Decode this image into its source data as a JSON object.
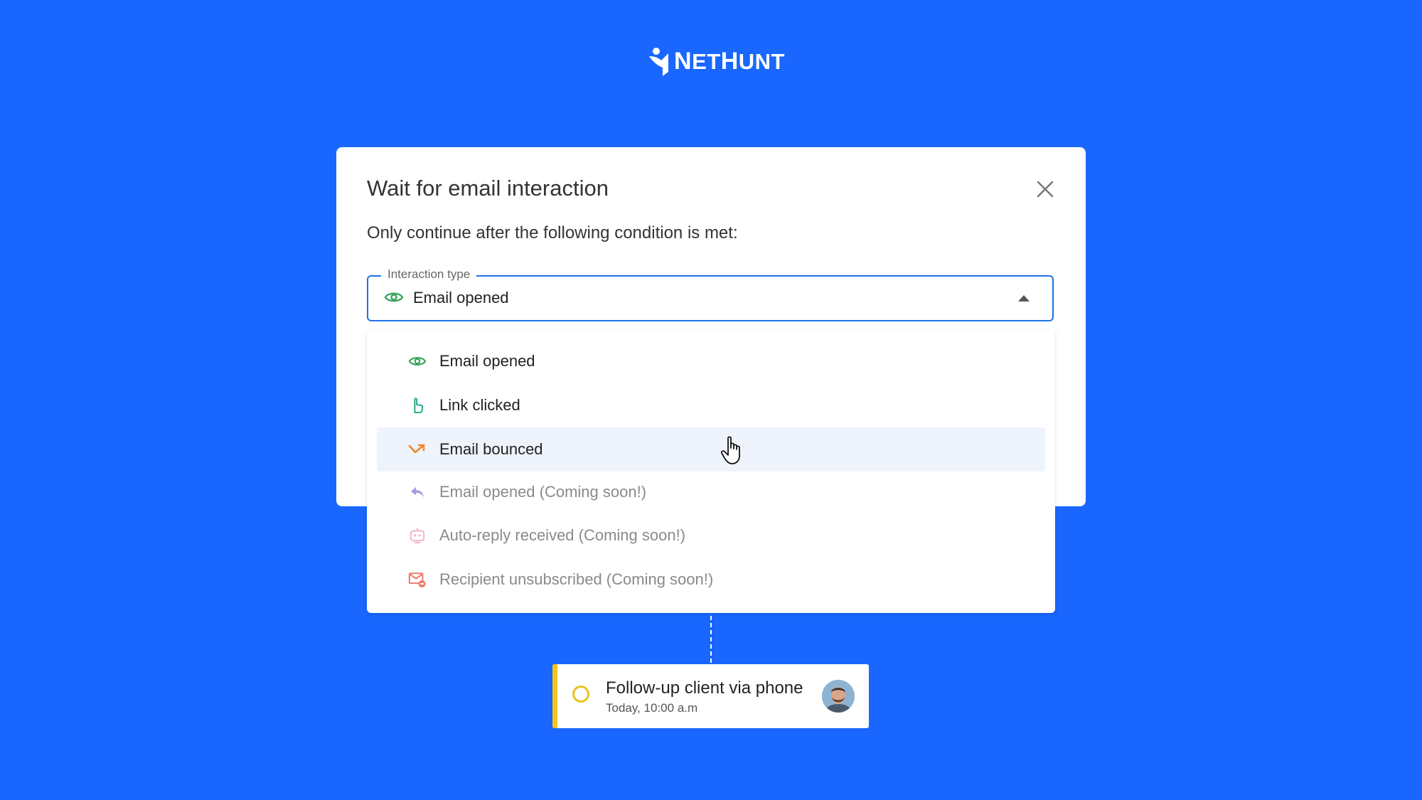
{
  "brand": {
    "name_prefix": "N",
    "name_mid": "ET",
    "name_h": "H",
    "name_end": "UNT"
  },
  "modal": {
    "title": "Wait for email interaction",
    "subtitle": "Only continue after the following condition is met:",
    "close_icon": "close-icon"
  },
  "select": {
    "legend": "Interaction type",
    "value": "Email opened",
    "icon": "eye-icon"
  },
  "options": [
    {
      "label": "Email opened",
      "icon": "eye-icon",
      "color": "#3BA55C",
      "disabled": false
    },
    {
      "label": "Link clicked",
      "icon": "pointer-finger-icon",
      "color": "#2BAE8F",
      "disabled": false
    },
    {
      "label": "Email bounced",
      "icon": "bounce-arrow-icon",
      "color": "#F08A24",
      "disabled": false,
      "hovered": true
    },
    {
      "label": "Email opened (Coming soon!)",
      "icon": "reply-arrow-icon",
      "color": "#A89AE0",
      "disabled": true
    },
    {
      "label": "Auto-reply received (Coming soon!)",
      "icon": "robot-icon",
      "color": "#F3B3CC",
      "disabled": true
    },
    {
      "label": "Recipient unsubscribed (Coming soon!)",
      "icon": "mail-unsubscribe-icon",
      "color": "#EE7C6B",
      "disabled": true
    }
  ],
  "task": {
    "title": "Follow-up client via phone",
    "time": "Today, 10:00 a.m",
    "accent": "#F5C518"
  },
  "colors": {
    "background": "#1967FE",
    "select_border": "#1E73E8",
    "hover_row": "#EEF3FC"
  }
}
